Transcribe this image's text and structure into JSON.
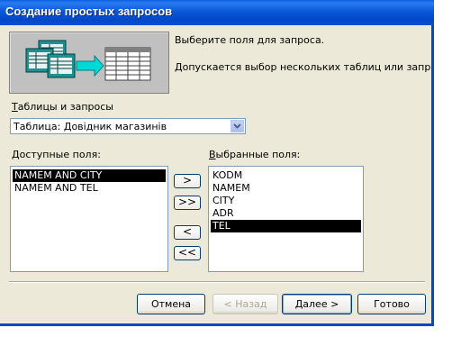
{
  "window": {
    "title": "Создание простых запросов"
  },
  "info": {
    "line1": "Выберите поля для запроса.",
    "line2": "Допускается выбор нескольких таблиц или запросов."
  },
  "source": {
    "label": "Таблицы и запросы",
    "selected": "Таблица: Довідник магазинів"
  },
  "available": {
    "label": "Доступные поля:",
    "items": [
      "NAMEM AND CITY",
      "NAMEM AND TEL"
    ]
  },
  "selected_fields": {
    "label": "Выбранные поля:",
    "items": [
      "KODM",
      "NAMEM",
      "CITY",
      "ADR",
      "TEL"
    ]
  },
  "move_buttons": {
    "add_one": ">",
    "add_all": ">>",
    "remove_one": "<",
    "remove_all": "<<"
  },
  "footer": {
    "cancel": "Отмена",
    "back": "< Назад",
    "next": "Далее >",
    "finish": "Готово"
  },
  "colors": {
    "titlebar": "#0a58d8",
    "dialog_bg": "#ece9d8",
    "selection": "#000000"
  }
}
